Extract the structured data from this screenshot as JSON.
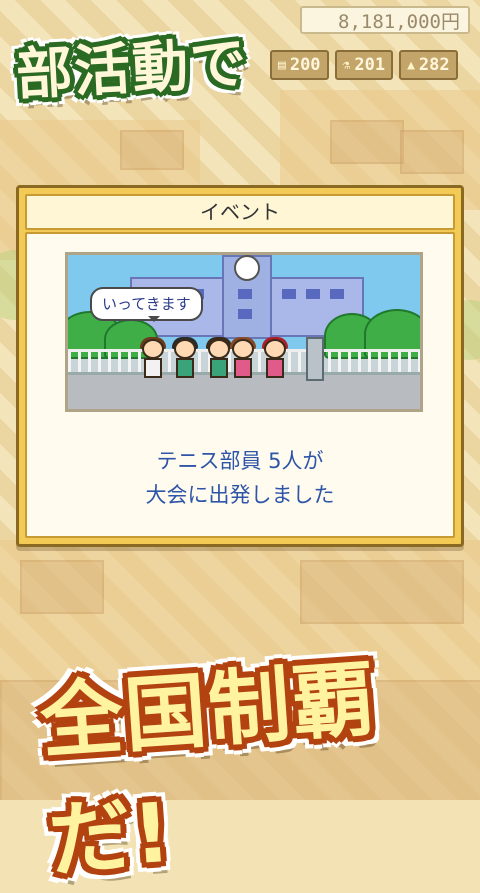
{
  "status": {
    "money": "8,181,000円",
    "stats": [
      {
        "icon": "book-icon",
        "value": "200"
      },
      {
        "icon": "flask-icon",
        "value": "201"
      },
      {
        "icon": "dumbbell-icon",
        "value": "282"
      }
    ]
  },
  "promo": {
    "top": "部活動で",
    "bottom": "全国制覇だ!"
  },
  "dialog": {
    "title": "イベント",
    "speech": "いってきます",
    "message_line1": "テニス部員  5人が",
    "message_line2": "大会に出発しました"
  }
}
